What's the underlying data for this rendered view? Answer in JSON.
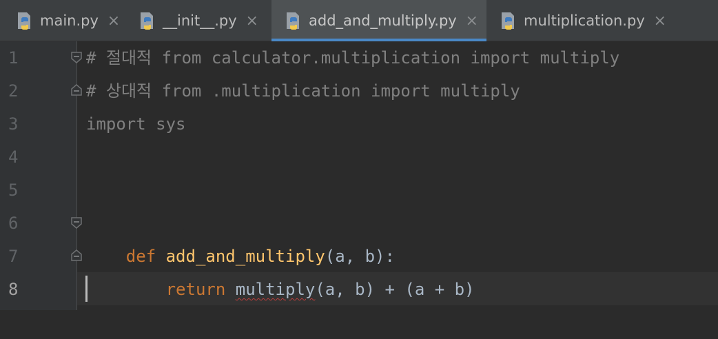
{
  "tabs": [
    {
      "label": "main.py",
      "active": false
    },
    {
      "label": "__init__.py",
      "active": false
    },
    {
      "label": "add_and_multiply.py",
      "active": true
    },
    {
      "label": "multiplication.py",
      "active": false
    }
  ],
  "close_glyph": "×",
  "line_numbers": [
    "1",
    "2",
    "3",
    "4",
    "5",
    "6",
    "7",
    "8"
  ],
  "code": {
    "line1": "# 절대적 from calculator.multiplication import multiply",
    "line2": "# 상대적 from .multiplication import multiply",
    "line3": "import sys",
    "line6": {
      "kw": "def",
      "fn": "add_and_multiply",
      "rest": "(a, b):"
    },
    "line7": {
      "indent": "    ",
      "kw": "return",
      "call": "multiply",
      "rest": "(a, b) + (a + b)"
    }
  },
  "colors": {
    "accent": "#4a88c7",
    "keyword": "#cc7832",
    "function": "#ffc66d",
    "comment": "#808080",
    "error_underline": "#bc3f3c"
  }
}
